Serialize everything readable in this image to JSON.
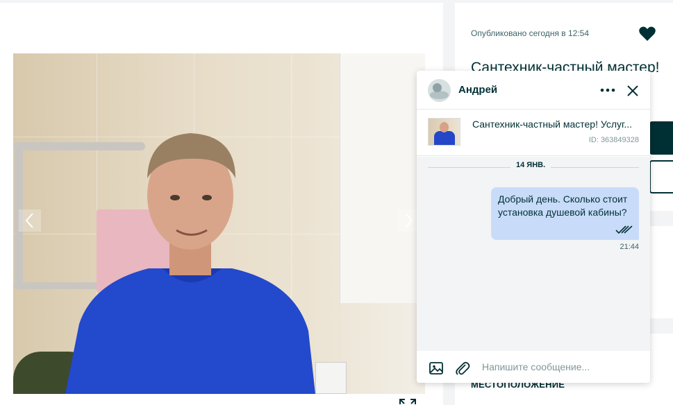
{
  "listing": {
    "published": "Опубликовано сегодня в 12:54",
    "title": "Сантехник-частный мастер!",
    "location_heading": "МЕСТОПОЛОЖЕНИЕ"
  },
  "icons": {
    "favorite": "heart-icon",
    "gallery_prev": "chevron-left-icon",
    "gallery_next": "chevron-right-icon",
    "fullscreen": "expand-icon",
    "more": "more-dots-icon",
    "close": "close-icon",
    "attach_image": "image-icon",
    "attach_file": "paperclip-icon",
    "read_receipt": "double-check-icon"
  },
  "chat": {
    "contact_name": "Андрей",
    "ad": {
      "title": "Сантехник-частный мастер! Услуг...",
      "id": "ID: 363849328"
    },
    "date_separator": "14 ЯНВ.",
    "messages": [
      {
        "text": "Добрый день. Сколько стоит установка душевой кабины?",
        "time": "21:44",
        "outgoing": true,
        "read": true
      }
    ],
    "composer_placeholder": "Напишите сообщение..."
  },
  "colors": {
    "brand_dark": "#002f34",
    "bubble_outgoing": "#c8dcfa",
    "chat_background": "#f2f4f5",
    "muted_text": "#7f9799"
  }
}
